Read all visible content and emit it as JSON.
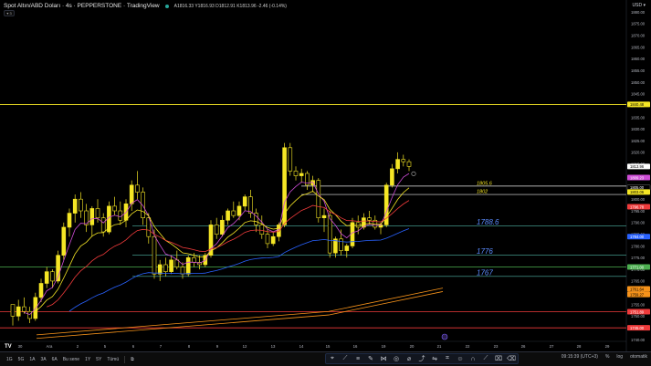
{
  "legend": {
    "symbol": "Spot Altın/ABD Doları · 4s · PEPPERSTONE · TradingView",
    "ohlc": "A1816.33  Y1816.93  D1812.91  K1813.96  -2.46 (-0.14%)"
  },
  "collapse_label": "▾ 3",
  "currency": "USD ▾",
  "price_axis": {
    "ticks": [
      "1880.00",
      "1875.00",
      "1870.00",
      "1865.00",
      "1860.00",
      "1855.00",
      "1850.00",
      "1845.00",
      "1840.00",
      "1835.00",
      "1830.00",
      "1825.00",
      "1820.00",
      "1815.00",
      "1810.00",
      "1805.00",
      "1800.00",
      "1795.00",
      "1790.00",
      "1785.00",
      "1780.00",
      "1775.00",
      "1770.00",
      "1765.00",
      "1760.00",
      "1755.00",
      "1750.00",
      "1745.00",
      "1740.00"
    ],
    "badges": [
      {
        "label": "1840.48",
        "color": "#f5e625",
        "text_color": "#000"
      },
      {
        "label": "1813.96",
        "color": "#ffffff",
        "text_color": "#000"
      },
      {
        "label": "1809.23",
        "color": "#ce4dd6",
        "text_color": "#fff"
      },
      {
        "label": "1805.00",
        "color": "#000000",
        "text_color": "#fff"
      },
      {
        "label": "1803.06",
        "color": "#f5e625",
        "text_color": "#000"
      },
      {
        "label": "1796.78",
        "color": "#ef3b3b",
        "text_color": "#fff"
      },
      {
        "label": "1784.00",
        "color": "#2962ff",
        "text_color": "#fff"
      },
      {
        "label": "1771.00",
        "color": "#4caf50",
        "text_color": "#fff"
      },
      {
        "label": "1761.64",
        "color": "#f7931a",
        "text_color": "#000"
      },
      {
        "label": "1759.27",
        "color": "#f7931a",
        "text_color": "#000"
      },
      {
        "label": "1751.89",
        "color": "#ef3b3b",
        "text_color": "#fff"
      },
      {
        "label": "1745.00",
        "color": "#ef3b3b",
        "text_color": "#fff"
      }
    ]
  },
  "time_axis": [
    "30",
    "Ara",
    "2",
    "5",
    "6",
    "7",
    "8",
    "9",
    "12",
    "13",
    "14",
    "15",
    "16",
    "19",
    "20",
    "21",
    "22",
    "23",
    "26",
    "27",
    "28",
    "29"
  ],
  "levels": [
    {
      "label": "1805.6",
      "price": 1805.6,
      "style": "yellow-text"
    },
    {
      "label": "1802",
      "price": 1802,
      "style": "yellow-text"
    },
    {
      "label": "1788.6",
      "price": 1788.6,
      "style": "blue-text"
    },
    {
      "label": "1776",
      "price": 1776,
      "style": "blue-text"
    },
    {
      "label": "1767",
      "price": 1767,
      "style": "blue-text"
    }
  ],
  "timeframes": [
    "1G",
    "5G",
    "1A",
    "3A",
    "6A",
    "Bu sene",
    "1Y",
    "5Y",
    "Tümü"
  ],
  "bottom_right": {
    "time": "09:15:39 (UTC+3)",
    "percent": "%",
    "log": "log",
    "auto": "otomatik"
  },
  "tv_logo": "TV",
  "chart_data": {
    "type": "candlestick",
    "series_name": "XAUUSD 4h",
    "ylim": [
      1740,
      1882
    ],
    "candles": [
      [
        1755,
        1752,
        1746,
        1750
      ],
      [
        1750,
        1757,
        1748,
        1754
      ],
      [
        1754,
        1758,
        1751,
        1752
      ],
      [
        1752,
        1754,
        1747,
        1749
      ],
      [
        1749,
        1760,
        1748,
        1758
      ],
      [
        1758,
        1766,
        1756,
        1764
      ],
      [
        1764,
        1771,
        1762,
        1769
      ],
      [
        1769,
        1770,
        1762,
        1765
      ],
      [
        1765,
        1778,
        1764,
        1776
      ],
      [
        1776,
        1790,
        1774,
        1788
      ],
      [
        1788,
        1796,
        1784,
        1794
      ],
      [
        1794,
        1802,
        1790,
        1800
      ],
      [
        1800,
        1803,
        1792,
        1795
      ],
      [
        1795,
        1798,
        1786,
        1789
      ],
      [
        1789,
        1797,
        1784,
        1796
      ],
      [
        1796,
        1800,
        1790,
        1792
      ],
      [
        1792,
        1794,
        1784,
        1786
      ],
      [
        1786,
        1799,
        1785,
        1797
      ],
      [
        1797,
        1801,
        1793,
        1795
      ],
      [
        1795,
        1799,
        1789,
        1791
      ],
      [
        1791,
        1800,
        1788,
        1798
      ],
      [
        1798,
        1808,
        1795,
        1806
      ],
      [
        1806,
        1812,
        1800,
        1803
      ],
      [
        1803,
        1805,
        1789,
        1792
      ],
      [
        1792,
        1794,
        1781,
        1784
      ],
      [
        1784,
        1787,
        1766,
        1768
      ],
      [
        1768,
        1774,
        1765,
        1772
      ],
      [
        1772,
        1775,
        1767,
        1769
      ],
      [
        1769,
        1776,
        1768,
        1774
      ],
      [
        1774,
        1778,
        1770,
        1771
      ],
      [
        1771,
        1773,
        1766,
        1768
      ],
      [
        1768,
        1776,
        1767,
        1775
      ],
      [
        1775,
        1777,
        1771,
        1773
      ],
      [
        1773,
        1776,
        1770,
        1772
      ],
      [
        1772,
        1777,
        1771,
        1776
      ],
      [
        1776,
        1791,
        1775,
        1789
      ],
      [
        1789,
        1792,
        1783,
        1785
      ],
      [
        1785,
        1793,
        1784,
        1791
      ],
      [
        1791,
        1796,
        1789,
        1795
      ],
      [
        1795,
        1799,
        1792,
        1793
      ],
      [
        1793,
        1799,
        1791,
        1797
      ],
      [
        1797,
        1802,
        1795,
        1801
      ],
      [
        1801,
        1804,
        1792,
        1794
      ],
      [
        1794,
        1796,
        1786,
        1789
      ],
      [
        1789,
        1793,
        1783,
        1785
      ],
      [
        1785,
        1787,
        1779,
        1781
      ],
      [
        1781,
        1786,
        1780,
        1784
      ],
      [
        1784,
        1790,
        1782,
        1789
      ],
      [
        1789,
        1824,
        1788,
        1822
      ],
      [
        1822,
        1824,
        1810,
        1812
      ],
      [
        1812,
        1814,
        1808,
        1810
      ],
      [
        1810,
        1813,
        1807,
        1811
      ],
      [
        1811,
        1812,
        1804,
        1806
      ],
      [
        1806,
        1810,
        1803,
        1808
      ],
      [
        1808,
        1809,
        1790,
        1792
      ],
      [
        1792,
        1796,
        1786,
        1793
      ],
      [
        1793,
        1795,
        1775,
        1777
      ],
      [
        1777,
        1784,
        1775,
        1783
      ],
      [
        1783,
        1787,
        1776,
        1778
      ],
      [
        1778,
        1781,
        1775,
        1780
      ],
      [
        1780,
        1792,
        1779,
        1790
      ],
      [
        1790,
        1793,
        1785,
        1788
      ],
      [
        1788,
        1794,
        1787,
        1792
      ],
      [
        1792,
        1795,
        1789,
        1791
      ],
      [
        1791,
        1793,
        1787,
        1788
      ],
      [
        1788,
        1790,
        1785,
        1789
      ],
      [
        1789,
        1807,
        1788,
        1806
      ],
      [
        1806,
        1815,
        1805,
        1813
      ],
      [
        1813,
        1820,
        1811,
        1817
      ],
      [
        1817,
        1819,
        1814,
        1816
      ],
      [
        1816,
        1817,
        1812,
        1814
      ]
    ]
  }
}
